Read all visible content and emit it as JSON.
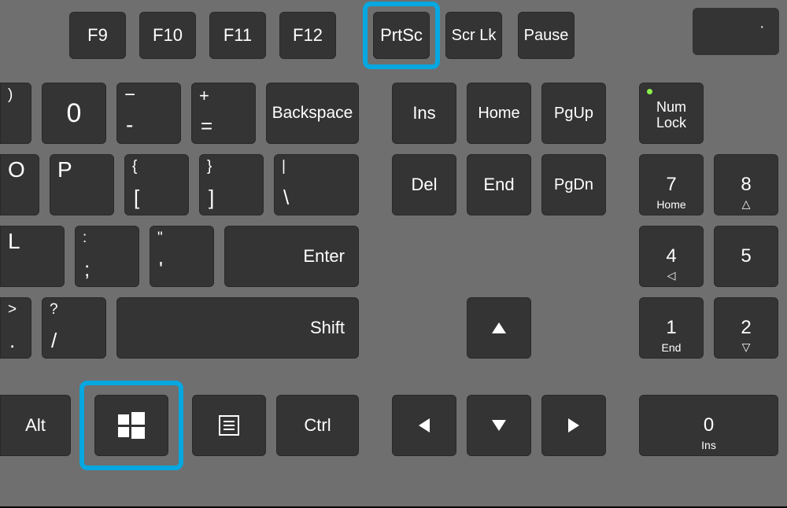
{
  "highlight_color": "#07a7e0",
  "row_function": {
    "keys": [
      {
        "label": "F9"
      },
      {
        "label": "F10"
      },
      {
        "label": "F11"
      },
      {
        "label": "F12"
      },
      {
        "label": "PrtSc",
        "highlighted": true
      },
      {
        "label": "Scr Lk"
      },
      {
        "label": "Pause"
      }
    ]
  },
  "row_num": {
    "keys": [
      {
        "top": ")",
        "bottom": "0"
      },
      {
        "top": "_",
        "bottom": "-"
      },
      {
        "top": "+",
        "bottom": "="
      },
      {
        "label": "Backspace"
      }
    ],
    "nav": [
      "Ins",
      "Home",
      "PgUp"
    ],
    "numlock": {
      "label": "Num\nLock",
      "led": true
    }
  },
  "row_qwerty": {
    "keys": [
      {
        "main": "O"
      },
      {
        "main": "P"
      },
      {
        "top": "{",
        "bottom": "["
      },
      {
        "top": "}",
        "bottom": "]"
      },
      {
        "top": "|",
        "bottom": "\\"
      }
    ],
    "nav": [
      "Del",
      "End",
      "PgDn"
    ],
    "numpad": [
      {
        "main": "7",
        "sub": "Home"
      },
      {
        "main": "8",
        "sub": "△"
      }
    ]
  },
  "row_home": {
    "keys": [
      {
        "main": "L"
      },
      {
        "top": ":",
        "bottom": ";"
      },
      {
        "top": "\"",
        "bottom": "'"
      },
      {
        "label": "Enter"
      }
    ],
    "numpad": [
      {
        "main": "4",
        "sub": "◁"
      },
      {
        "main": "5"
      }
    ]
  },
  "row_shift": {
    "keys": [
      {
        "top": ">",
        "bottom": "."
      },
      {
        "top": "?",
        "bottom": "/"
      },
      {
        "label": "Shift"
      }
    ],
    "arrow_up": "▲",
    "numpad": [
      {
        "main": "1",
        "sub": "End"
      },
      {
        "main": "2",
        "sub": "▽"
      }
    ]
  },
  "row_bottom": {
    "keys": [
      {
        "label": "Alt"
      },
      {
        "icon": "windows",
        "highlighted": true
      },
      {
        "icon": "menu"
      },
      {
        "label": "Ctrl"
      }
    ],
    "arrows": [
      "◄",
      "▼",
      "►"
    ],
    "numpad": [
      {
        "main": "0",
        "sub": "Ins"
      }
    ]
  }
}
